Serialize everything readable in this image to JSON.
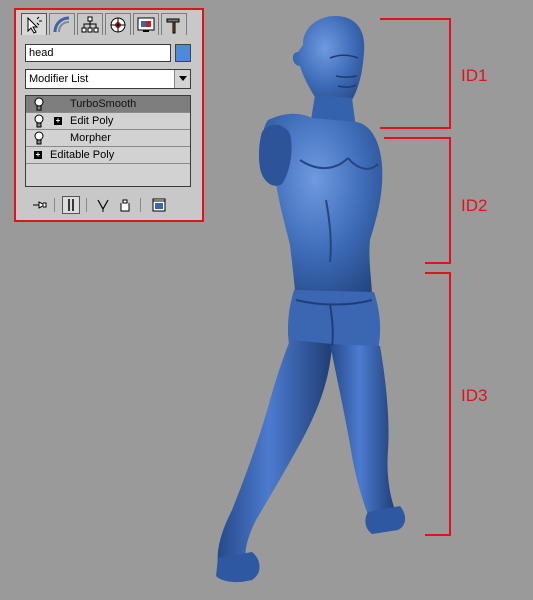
{
  "command_panel": {
    "tabs": [
      {
        "icon": "create-icon"
      },
      {
        "icon": "modify-icon"
      },
      {
        "icon": "hierarchy-icon"
      },
      {
        "icon": "motion-icon"
      },
      {
        "icon": "display-icon"
      },
      {
        "icon": "utilities-icon"
      }
    ],
    "object_name": "head",
    "object_color": "#4f8ad8",
    "modifier_list_label": "Modifier List",
    "stack": [
      {
        "label": "TurboSmooth",
        "selected": true,
        "bulb": true,
        "expandable": false
      },
      {
        "label": "Edit Poly",
        "selected": false,
        "bulb": true,
        "expandable": true
      },
      {
        "label": "Morpher",
        "selected": false,
        "bulb": true,
        "expandable": false
      },
      {
        "label": "Editable Poly",
        "selected": false,
        "bulb": false,
        "expandable": true
      }
    ],
    "stack_tools": [
      "pin-stack-icon",
      "show-end-result-icon",
      "make-unique-icon",
      "remove-modifier-icon",
      "configure-modifier-sets-icon"
    ]
  },
  "annotations": {
    "id1": "ID1",
    "id2": "ID2",
    "id3": "ID3",
    "color": "#e0121b"
  },
  "model": {
    "color": "#3e6cb8"
  }
}
